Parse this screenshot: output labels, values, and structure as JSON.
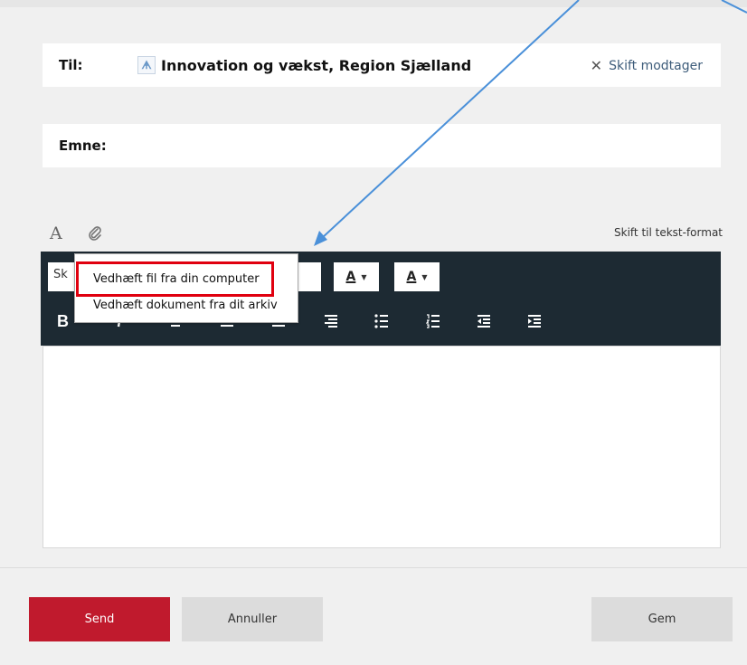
{
  "recipient_row": {
    "label": "Til:",
    "recipient": "Innovation og vækst, Region Sjælland",
    "change_label": "Skift modtager",
    "icon": "recipient-org-icon"
  },
  "subject_row": {
    "label": "Emne:"
  },
  "editor_header": {
    "format_icon": "A",
    "attach_icon": "paperclip-icon",
    "switch_label": "Skift til tekst-format"
  },
  "toolbar": {
    "font_value": "Sk",
    "fore_color_label": "A",
    "back_color_label": "A",
    "bold_label": "B"
  },
  "attach_menu": {
    "item_computer": "Vedhæft fil fra din computer",
    "item_archive": "Vedhæft dokument fra dit arkiv"
  },
  "footer": {
    "send_label": "Send",
    "cancel_label": "Annuller",
    "save_label": "Gem"
  },
  "colors": {
    "send": "#c01a2d",
    "toolbar": "#1d2a33",
    "highlight": "#e0000f",
    "arrow": "#4a90d9"
  }
}
